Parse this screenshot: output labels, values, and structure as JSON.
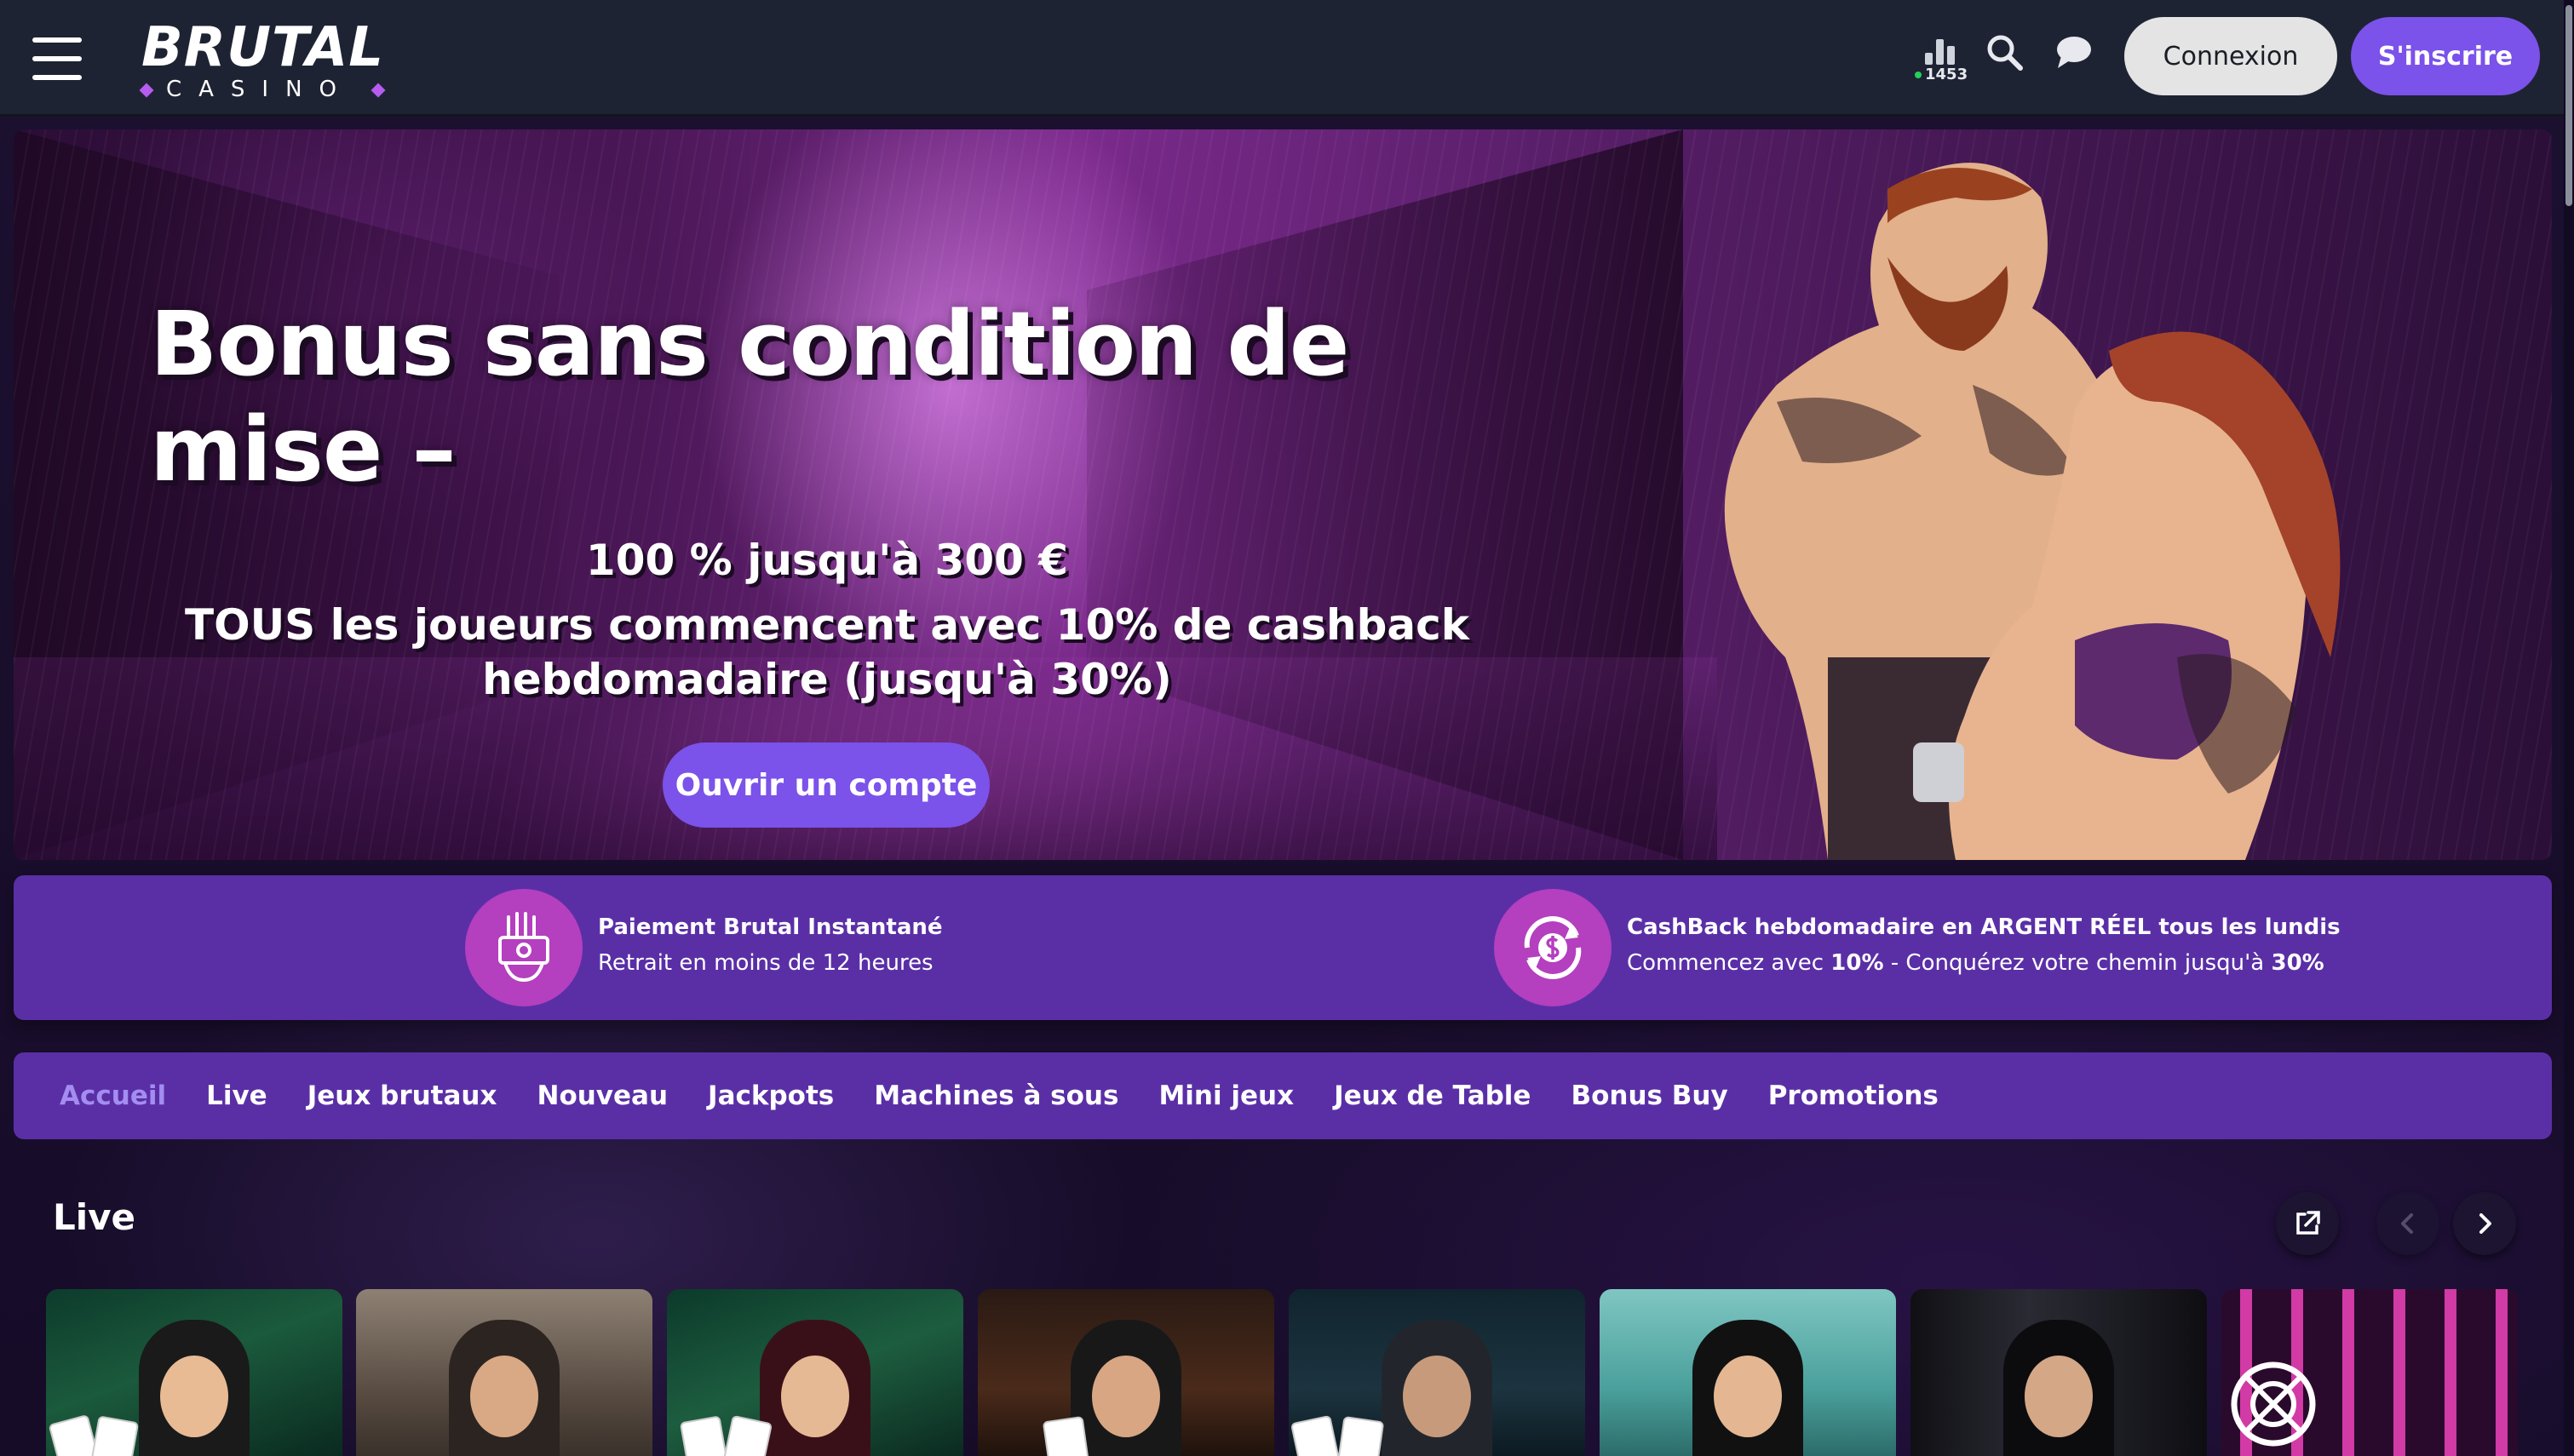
{
  "header": {
    "brand_name": "BRUTAL",
    "brand_sub": "CASINO",
    "online_count": "1453",
    "login_label": "Connexion",
    "signup_label": "S'inscrire",
    "icons": [
      "menu-icon",
      "stats-bars-icon",
      "search-icon",
      "chat-icon"
    ]
  },
  "hero": {
    "title": "Bonus sans condition de mise –",
    "line1": "100 % jusqu'à 300 €",
    "line2a": "TOUS les joueurs commencent avec 10% de cashback",
    "line2b": "hebdomadaire (jusqu'à 30%)",
    "cta": "Ouvrir un compte"
  },
  "features": [
    {
      "icon": "payment-hand-icon",
      "title": "Paiement Brutal Instantané",
      "desc": "Retrait en moins de 12 heures"
    },
    {
      "icon": "cashback-dollar-icon",
      "title": "CashBack hebdomadaire en ARGENT RÉEL tous les lundis",
      "desc_parts": [
        "Commencez avec ",
        "10%",
        " - Conquérez votre chemin jusqu'à ",
        "30%"
      ]
    }
  ],
  "categories": [
    {
      "label": "Accueil",
      "active": true
    },
    {
      "label": "Live",
      "active": false
    },
    {
      "label": "Jeux brutaux",
      "active": false
    },
    {
      "label": "Nouveau",
      "active": false
    },
    {
      "label": "Jackpots",
      "active": false
    },
    {
      "label": "Machines à sous",
      "active": false
    },
    {
      "label": "Mini jeux",
      "active": false
    },
    {
      "label": "Jeux de Table",
      "active": false
    },
    {
      "label": "Bonus Buy",
      "active": false
    },
    {
      "label": "Promotions",
      "active": false
    }
  ],
  "live_section": {
    "title": "Live",
    "icons": [
      "external-link-icon",
      "chevron-left-icon",
      "chevron-right-icon"
    ]
  },
  "colors": {
    "accent": "#7b52ea",
    "nav_bg": "#5a2fa6",
    "header_bg": "#1e2333",
    "active_tab": "#a48df0",
    "feature_icon_bg": "#b43fbf"
  }
}
